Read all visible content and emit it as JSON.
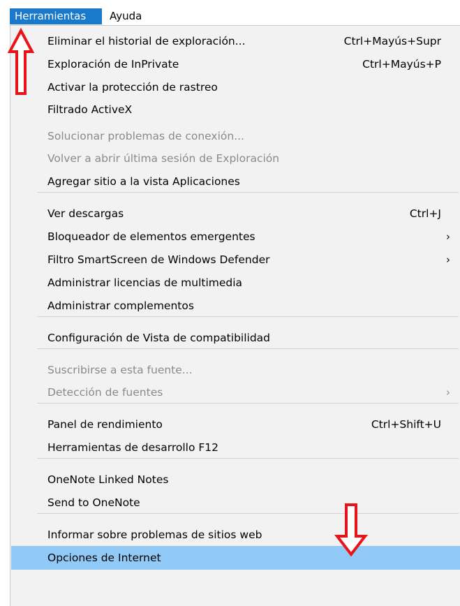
{
  "menubar": {
    "tools": "Herramientas",
    "help": "Ayuda"
  },
  "menu": {
    "items": [
      {
        "label": "Eliminar el historial de exploración...",
        "shortcut": "Ctrl+Mayús+Supr",
        "arrow": "",
        "disabled": false
      },
      {
        "label": "Exploración de InPrivate",
        "shortcut": "Ctrl+Mayús+P",
        "arrow": "",
        "disabled": false
      },
      {
        "label": "Activar la protección de rastreo",
        "shortcut": "",
        "arrow": "",
        "disabled": false
      },
      {
        "label": "Filtrado ActiveX",
        "shortcut": "",
        "arrow": "",
        "disabled": false
      },
      {
        "label": "Solucionar problemas de conexión...",
        "shortcut": "",
        "arrow": "",
        "disabled": true
      },
      {
        "label": "Volver a abrir última sesión de Exploración",
        "shortcut": "",
        "arrow": "",
        "disabled": true
      },
      {
        "label": "Agregar sitio a la vista Aplicaciones",
        "shortcut": "",
        "arrow": "",
        "disabled": false
      },
      {
        "label": "Ver descargas",
        "shortcut": "Ctrl+J",
        "arrow": "",
        "disabled": false
      },
      {
        "label": "Bloqueador de elementos emergentes",
        "shortcut": "",
        "arrow": "›",
        "disabled": false
      },
      {
        "label": "Filtro SmartScreen de Windows Defender",
        "shortcut": "",
        "arrow": "›",
        "disabled": false
      },
      {
        "label": "Administrar licencias de multimedia",
        "shortcut": "",
        "arrow": "",
        "disabled": false
      },
      {
        "label": "Administrar complementos",
        "shortcut": "",
        "arrow": "",
        "disabled": false
      },
      {
        "label": "Configuración de Vista de compatibilidad",
        "shortcut": "",
        "arrow": "",
        "disabled": false
      },
      {
        "label": "Suscribirse a esta fuente...",
        "shortcut": "",
        "arrow": "",
        "disabled": true
      },
      {
        "label": "Detección de fuentes",
        "shortcut": "",
        "arrow": "›",
        "disabled": true
      },
      {
        "label": "Panel de rendimiento",
        "shortcut": "Ctrl+Shift+U",
        "arrow": "",
        "disabled": false
      },
      {
        "label": "Herramientas de desarrollo F12",
        "shortcut": "",
        "arrow": "",
        "disabled": false
      },
      {
        "label": "OneNote Linked Notes",
        "shortcut": "",
        "arrow": "",
        "disabled": false
      },
      {
        "label": "Send to OneNote",
        "shortcut": "",
        "arrow": "",
        "disabled": false
      },
      {
        "label": "Informar sobre problemas de sitios web",
        "shortcut": "",
        "arrow": "",
        "disabled": false
      },
      {
        "label": "Opciones de Internet",
        "shortcut": "",
        "arrow": "",
        "disabled": false,
        "selected": true
      }
    ]
  },
  "colors": {
    "menubar_active": "#1979ca",
    "selected_item": "#91c9f7",
    "menu_bg": "#f2f2f2",
    "disabled_text": "#8a8a8a",
    "annotation_arrow": "#e8141a"
  },
  "annotations": [
    "red-up-arrow-icon",
    "red-down-arrow-icon"
  ]
}
